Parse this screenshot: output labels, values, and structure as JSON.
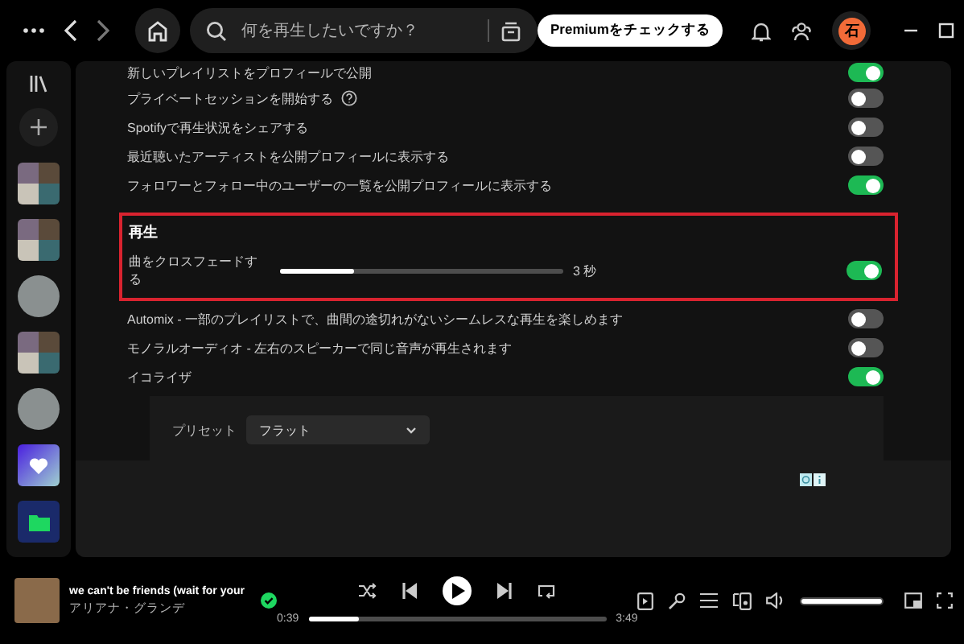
{
  "topbar": {
    "search": {
      "placeholder": "何を再生したいですか？"
    },
    "premium_button": "Premiumをチェックする",
    "avatar": "石"
  },
  "settings": [
    {
      "kind": "toggle",
      "label": "新しいプレイリストをプロフィールで公開",
      "on": true
    },
    {
      "kind": "toggle",
      "label": "プライベートセッションを開始する",
      "on": false,
      "help": true
    },
    {
      "kind": "toggle",
      "label": "Spotifyで再生状況をシェアする",
      "on": false
    },
    {
      "kind": "toggle",
      "label": "最近聴いたアーティストを公開プロフィールに表示する",
      "on": false
    },
    {
      "kind": "toggle",
      "label": "フォロワーとフォロー中のユーザーの一覧を公開プロフィールに表示する",
      "on": true
    }
  ],
  "playback": {
    "heading": "再生",
    "highlighted": true,
    "crossfade": {
      "label": "曲をクロスフェードする",
      "level": 0.26,
      "reading": "3 秒",
      "on": true
    },
    "items": [
      {
        "kind": "toggle",
        "label": "Automix - 一部のプレイリストで、曲間の途切れがないシームレスな再生を楽しめます",
        "on": false
      },
      {
        "kind": "toggle",
        "label": "モノラルオーディオ - 左右のスピーカーで同じ音声が再生されます",
        "on": false
      },
      {
        "kind": "toggle",
        "label": "イコライザ",
        "on": true
      }
    ],
    "equalizer": {
      "preset_label": "プリセット",
      "preset_value": "フラット"
    }
  },
  "player": {
    "title": "we can't be friends (wait for your",
    "artist": "アリアナ・グランデ",
    "saved": true,
    "elapsed": "0:39",
    "duration": "3:49",
    "level": 0.17,
    "volume": {
      "level": 1
    }
  }
}
